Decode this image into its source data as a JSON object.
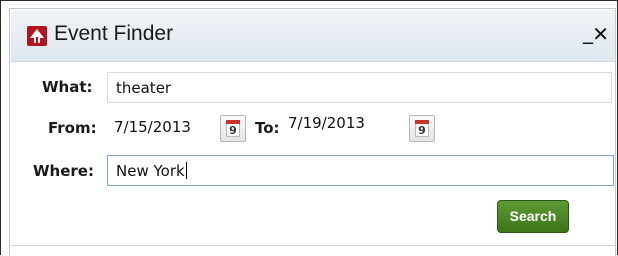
{
  "window": {
    "title": "Event Finder",
    "minimize_label": "_",
    "close_label": "✕"
  },
  "form": {
    "what_label": "What:",
    "what_value": "theater",
    "from_label": "From:",
    "from_value": "7/15/2013",
    "to_label": "To:",
    "to_value": "7/19/2013",
    "calendar_icon_day": "9",
    "where_label": "Where:",
    "where_value": "New York"
  },
  "actions": {
    "search_label": "Search"
  },
  "colors": {
    "accent_red": "#b3141d",
    "search_green": "#4a8526",
    "focus_border": "#7ea6d6"
  }
}
